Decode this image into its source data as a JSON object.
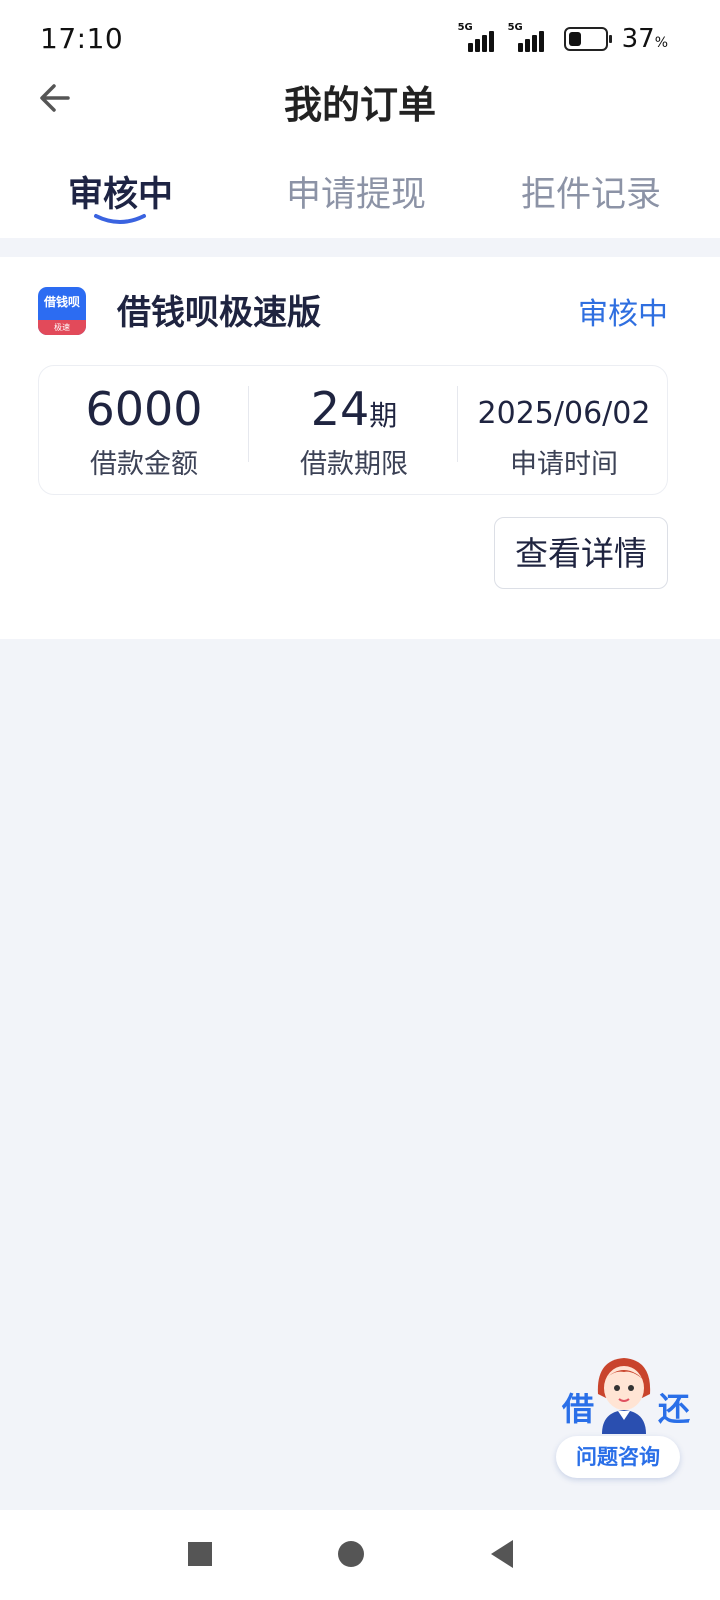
{
  "status_bar": {
    "time": "17:10",
    "signal_1": "5G",
    "signal_2": "5G",
    "battery_value": "37",
    "battery_unit": "%"
  },
  "nav": {
    "title": "我的订单",
    "back_icon": "arrow-left-icon"
  },
  "tabs": [
    {
      "label": "审核中",
      "active": true
    },
    {
      "label": "申请提现",
      "active": false
    },
    {
      "label": "拒件记录",
      "active": false
    }
  ],
  "order": {
    "app_icon": {
      "top_text": "借钱呗",
      "bottom_text": "极速"
    },
    "app_name": "借钱呗极速版",
    "status": "审核中",
    "amount_value": "6000",
    "amount_label": "借款金额",
    "term_value": "24",
    "term_unit": "期",
    "term_label": "借款期限",
    "date_value": "2025/06/02",
    "date_label": "申请时间",
    "detail_button": "查看详情"
  },
  "help": {
    "left": "借",
    "right": "还",
    "label": "问题咨询"
  },
  "colors": {
    "accent": "#2f6fe0",
    "background": "#f2f4f9",
    "tab_active": "#1e2444",
    "tab_inactive": "#8c93a6"
  }
}
